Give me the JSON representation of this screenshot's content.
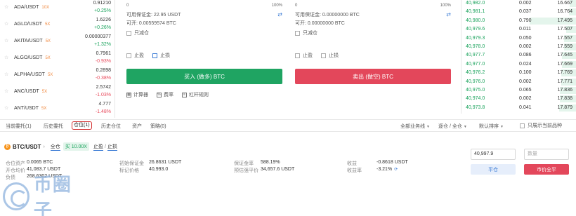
{
  "market_list": [
    {
      "symbol": "ADA/USDT",
      "leverage": "10X",
      "price": "0.91210",
      "change": "+0.25%",
      "dir": "up"
    },
    {
      "symbol": "AGLD/USDT",
      "leverage": "5X",
      "price": "1.6226",
      "change": "+0.26%",
      "dir": "up"
    },
    {
      "symbol": "AKITA/USDT",
      "leverage": "5X",
      "price": "0.00000377",
      "change": "+1.32%",
      "dir": "up"
    },
    {
      "symbol": "ALGO/USDT",
      "leverage": "5X",
      "price": "0.7961",
      "change": "-0.93%",
      "dir": "down"
    },
    {
      "symbol": "ALPHA/USDT",
      "leverage": "5X",
      "price": "0.2898",
      "change": "-0.38%",
      "dir": "down"
    },
    {
      "symbol": "ANC/USDT",
      "leverage": "5X",
      "price": "2.5742",
      "change": "-1.03%",
      "dir": "down"
    },
    {
      "symbol": "ANT/USDT",
      "leverage": "5X",
      "price": "4.777",
      "change": "-1.48%",
      "dir": "down"
    }
  ],
  "buy": {
    "slider_min": "0",
    "slider_max": "100%",
    "available": "可用保证金: 22.95 USDT",
    "can_open": "可开: 0.00559574 BTC",
    "reduce_only": "只减仓",
    "take_profit": "止盈",
    "stop_loss": "止损",
    "button": "买入 (做多) BTC"
  },
  "sell": {
    "slider_min": "0",
    "slider_max": "100%",
    "available": "可用保证金: 0.00000000 BTC",
    "can_open": "可开: 0.00000000 BTC",
    "reduce_only": "只减仓",
    "take_profit": "止盈",
    "stop_loss": "止损",
    "button": "卖出 (做空) BTC"
  },
  "tools": {
    "calculator": "计算器",
    "fee_rate": "费率",
    "leverage_rules": "杠杆规则"
  },
  "orderbook": [
    {
      "price": "40,982.0",
      "qty": "0.002",
      "total": "16.667",
      "depth": 0.14
    },
    {
      "price": "40,981.1",
      "qty": "0.037",
      "total": "16.764",
      "depth": 0.16
    },
    {
      "price": "40,980.0",
      "qty": "0.790",
      "total": "17.495",
      "depth": 0.95
    },
    {
      "price": "40,979.6",
      "qty": "0.011",
      "total": "17.507",
      "depth": 0.22
    },
    {
      "price": "40,979.3",
      "qty": "0.050",
      "total": "17.557",
      "depth": 0.25
    },
    {
      "price": "40,978.0",
      "qty": "0.002",
      "total": "17.559",
      "depth": 0.25
    },
    {
      "price": "40,977.7",
      "qty": "0.086",
      "total": "17.645",
      "depth": 0.3
    },
    {
      "price": "40,977.0",
      "qty": "0.024",
      "total": "17.669",
      "depth": 0.3
    },
    {
      "price": "40,976.2",
      "qty": "0.100",
      "total": "17.769",
      "depth": 0.32
    },
    {
      "price": "40,976.0",
      "qty": "0.002",
      "total": "17.771",
      "depth": 0.32
    },
    {
      "price": "40,975.0",
      "qty": "0.065",
      "total": "17.836",
      "depth": 0.34
    },
    {
      "price": "40,974.0",
      "qty": "0.002",
      "total": "17.838",
      "depth": 0.34
    },
    {
      "price": "40,973.8",
      "qty": "0.041",
      "total": "17.879",
      "depth": 0.36
    }
  ],
  "tabs": [
    "当前委托(1)",
    "历史委托",
    "仓位(1)",
    "历史仓位",
    "资产",
    "策略(0)"
  ],
  "filters": {
    "all_types": "全部业务线",
    "mode": "逐仓 / 全仓",
    "default_sort": "默认排序",
    "current_only": "只展示当前品种"
  },
  "position": {
    "symbol": "BTC/USDT",
    "mode": "全仓",
    "direction": "买 10.00X",
    "take_profit": "止盈",
    "stop_loss": "止损",
    "col1": [
      {
        "label": "仓位资产",
        "value": "0.0065 BTC"
      },
      {
        "label": "开仓均价",
        "value": "41,083.7 USDT"
      },
      {
        "label": "负债",
        "value": "268.6302 USDT"
      }
    ],
    "col2": [
      {
        "label": "初始保证金",
        "value": "26.8631 USDT"
      },
      {
        "label": "标记价格",
        "value": "40,993.0"
      }
    ],
    "col3": [
      {
        "label": "保证金率",
        "value": "588.19%"
      },
      {
        "label": "预估强平价",
        "value": "34,657.6 USDT"
      }
    ],
    "col4": [
      {
        "label": "收益",
        "value": "-0.8618 USDT"
      },
      {
        "label": "收益率",
        "value": "-3.21%"
      }
    ],
    "price_input": "40,997.9",
    "qty_placeholder": "数量",
    "close_button": "平仓",
    "market_close_button": "市价全平"
  },
  "watermark": {
    "text": "币圈子"
  }
}
